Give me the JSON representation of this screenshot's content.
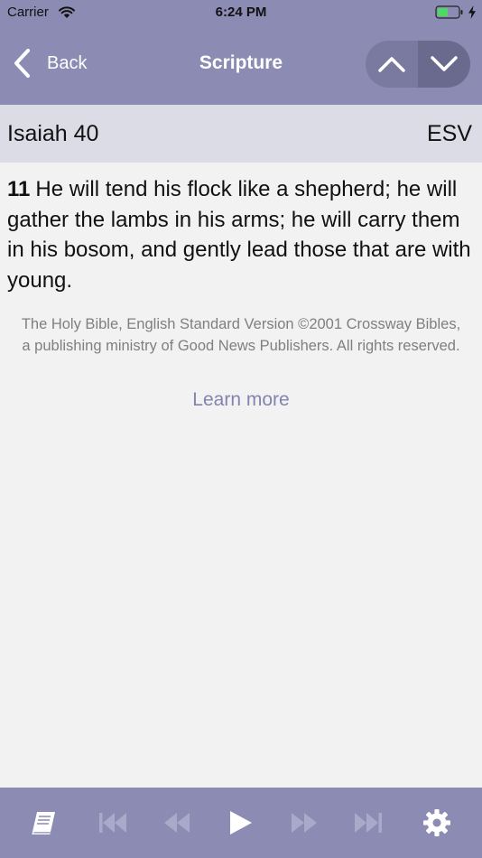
{
  "status_bar": {
    "carrier": "Carrier",
    "time": "6:24 PM",
    "icons": [
      "wifi-icon",
      "battery-icon",
      "charging-bolt-icon"
    ]
  },
  "nav": {
    "back_label": "Back",
    "title": "Scripture",
    "previous_verse_icon": "chevron-up-icon",
    "next_verse_icon": "chevron-down-icon"
  },
  "passage": {
    "reference": "Isaiah 40",
    "version": "ESV"
  },
  "verse": {
    "number": "11",
    "text": "He will tend his flock like a shepherd; he will gather the lambs in his arms; he will carry them in his bosom, and gently lead those that are with young."
  },
  "copyright": "The Holy Bible, English Standard Version ©2001 Crossway Bibles, a publishing ministry of Good News Publishers. All rights reserved.",
  "learn_more": "Learn more",
  "toolbar": {
    "items": [
      "book-icon",
      "skip-to-start-icon",
      "rewind-icon",
      "play-icon",
      "fast-forward-icon",
      "skip-to-end-icon",
      "gear-icon"
    ]
  },
  "colors": {
    "accent": "#8b8bb3",
    "header_band": "#dcdce6",
    "background": "#f2f2f2",
    "link": "#8383b0",
    "muted_text": "#7f7f7f",
    "active_icon": "#ffffff",
    "inactive_icon": "#a9a9c9",
    "battery_fill": "#4cd964"
  }
}
